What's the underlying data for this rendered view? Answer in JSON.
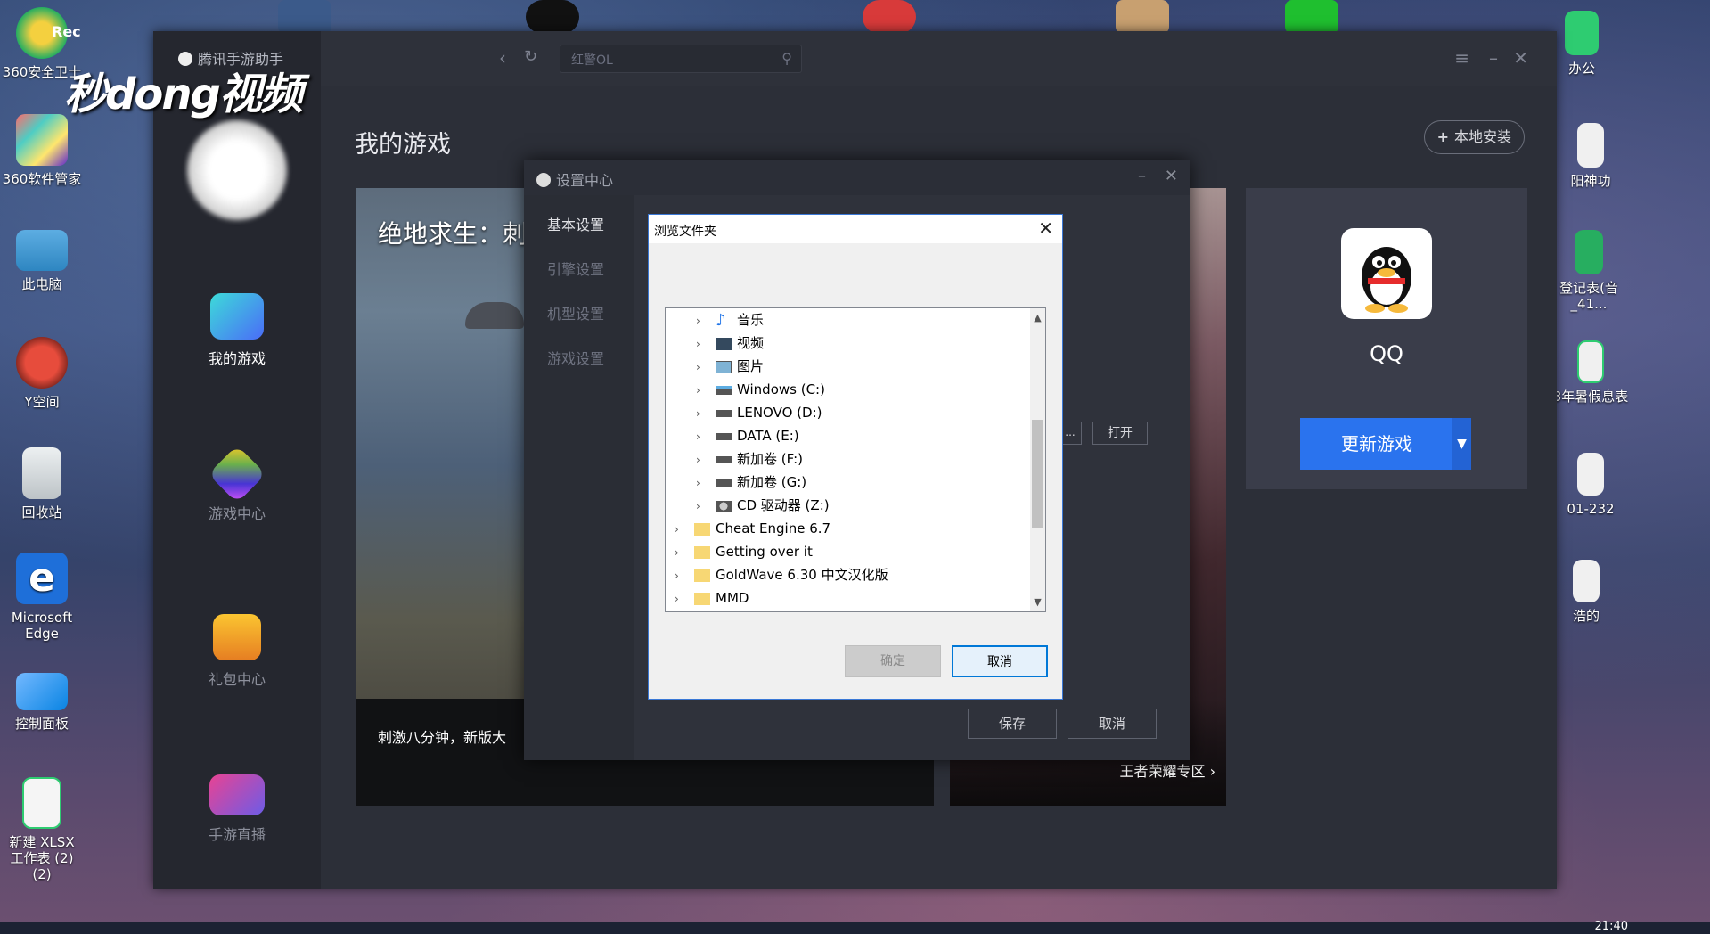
{
  "watermark": "秒dong视频",
  "rec_label": "Rec",
  "desktop_left": [
    {
      "label": "360安全卫士"
    },
    {
      "label": "360软件管家"
    },
    {
      "label": "此电脑"
    },
    {
      "label": "Y空间"
    },
    {
      "label": "回收站"
    },
    {
      "label": "Microsoft Edge"
    },
    {
      "label": "控制面板"
    },
    {
      "label": "新建 XLSX 工作表 (2)(2)"
    }
  ],
  "desktop_right": [
    {
      "label": "办公"
    },
    {
      "label": "阳神功"
    },
    {
      "label": "登记表(音_41..."
    },
    {
      "label": "3年暑假息表"
    },
    {
      "label": "01-232"
    },
    {
      "label": "浩的"
    }
  ],
  "app": {
    "title": "腾讯手游助手",
    "search_value": "红警OL",
    "nav": [
      {
        "label": "我的游戏"
      },
      {
        "label": "游戏中心"
      },
      {
        "label": "礼包中心"
      },
      {
        "label": "手游直播"
      }
    ],
    "page_title": "我的游戏",
    "local_install": "本地安装",
    "card1_title": "绝地求生：刺",
    "card1_footer": "刺激八分钟，新版大",
    "card2_footer": "王者荣耀专区",
    "qq_name": "QQ",
    "update_btn": "更新游戏"
  },
  "settings": {
    "title": "设置中心",
    "nav": [
      {
        "label": "基本设置"
      },
      {
        "label": "引擎设置"
      },
      {
        "label": "机型设置"
      },
      {
        "label": "游戏设置"
      }
    ],
    "browse_dots": "...",
    "open_btn": "打开",
    "save_btn": "保存",
    "cancel_btn": "取消"
  },
  "browse": {
    "title": "浏览文件夹",
    "items": [
      {
        "label": "音乐"
      },
      {
        "label": "视频"
      },
      {
        "label": "图片"
      },
      {
        "label": "Windows (C:)"
      },
      {
        "label": "LENOVO (D:)"
      },
      {
        "label": "DATA (E:)"
      },
      {
        "label": "新加卷 (F:)"
      },
      {
        "label": "新加卷 (G:)"
      },
      {
        "label": "CD 驱动器 (Z:)"
      },
      {
        "label": "Cheat Engine 6.7"
      },
      {
        "label": "Getting over it"
      },
      {
        "label": "GoldWave 6.30 中文汉化版"
      },
      {
        "label": "MMD"
      }
    ],
    "ok_btn": "确定",
    "cancel_btn": "取消"
  },
  "clock": "21:40"
}
